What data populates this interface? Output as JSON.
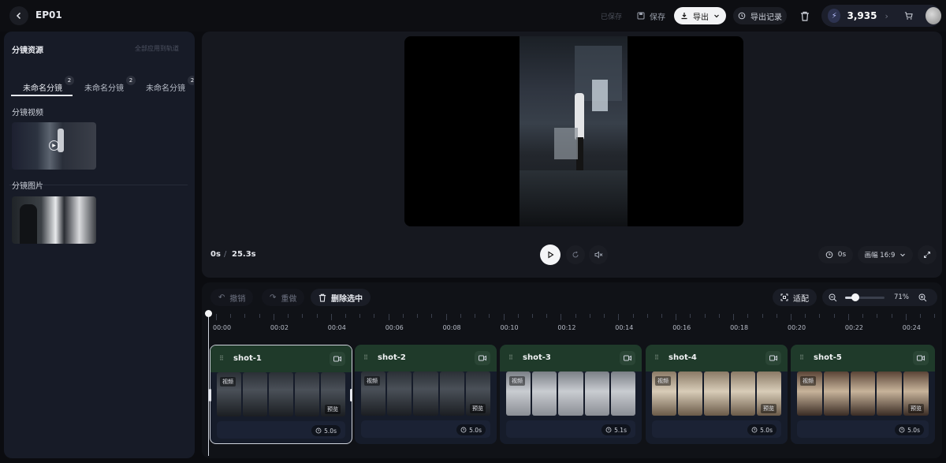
{
  "header": {
    "title": "EP01",
    "saved_status": "已保存",
    "save_label": "保存",
    "export_label": "导出",
    "export_history_label": "导出记录",
    "credits": "3,935"
  },
  "left_panel": {
    "title": "分镜资源",
    "action_label": "全部应用到轨道",
    "tabs": [
      {
        "label": "未命名分镜",
        "badge": "2"
      },
      {
        "label": "未命名分镜",
        "badge": "2"
      },
      {
        "label": "未命名分镜",
        "badge": "2"
      }
    ],
    "video_section_label": "分镜视频",
    "image_section_label": "分镜图片"
  },
  "player": {
    "current_time": "0s",
    "separator": "/",
    "total_time": "25.3s",
    "timer_label": "0s",
    "ratio_label": "画幅 16:9"
  },
  "timeline_toolbar": {
    "undo_label": "撤销",
    "redo_label": "重做",
    "delete_label": "删除选中",
    "fit_label": "适配",
    "zoom_label": "71%",
    "zoom_fraction": 0.25
  },
  "ruler": {
    "labels": [
      "00:00",
      "00:02",
      "00:04",
      "00:06",
      "00:08",
      "00:10",
      "00:12",
      "00:14",
      "00:16",
      "00:18",
      "00:20",
      "00:22",
      "00:24"
    ]
  },
  "clips": [
    {
      "name": "shot-1",
      "duration": "5.0s",
      "tag_left": "视频",
      "tag_right": "预览"
    },
    {
      "name": "shot-2",
      "duration": "5.0s",
      "tag_left": "视频",
      "tag_right": "预览"
    },
    {
      "name": "shot-3",
      "duration": "5.1s",
      "tag_left": "视频",
      "tag_right": ""
    },
    {
      "name": "shot-4",
      "duration": "5.0s",
      "tag_left": "视频",
      "tag_right": "预览"
    },
    {
      "name": "shot-5",
      "duration": "5.0s",
      "tag_left": "视频",
      "tag_right": "预览"
    }
  ],
  "colors": {
    "accent_green": "#1f3a2a",
    "selected_border": "#cfd3dc",
    "panel": "#171b27"
  }
}
